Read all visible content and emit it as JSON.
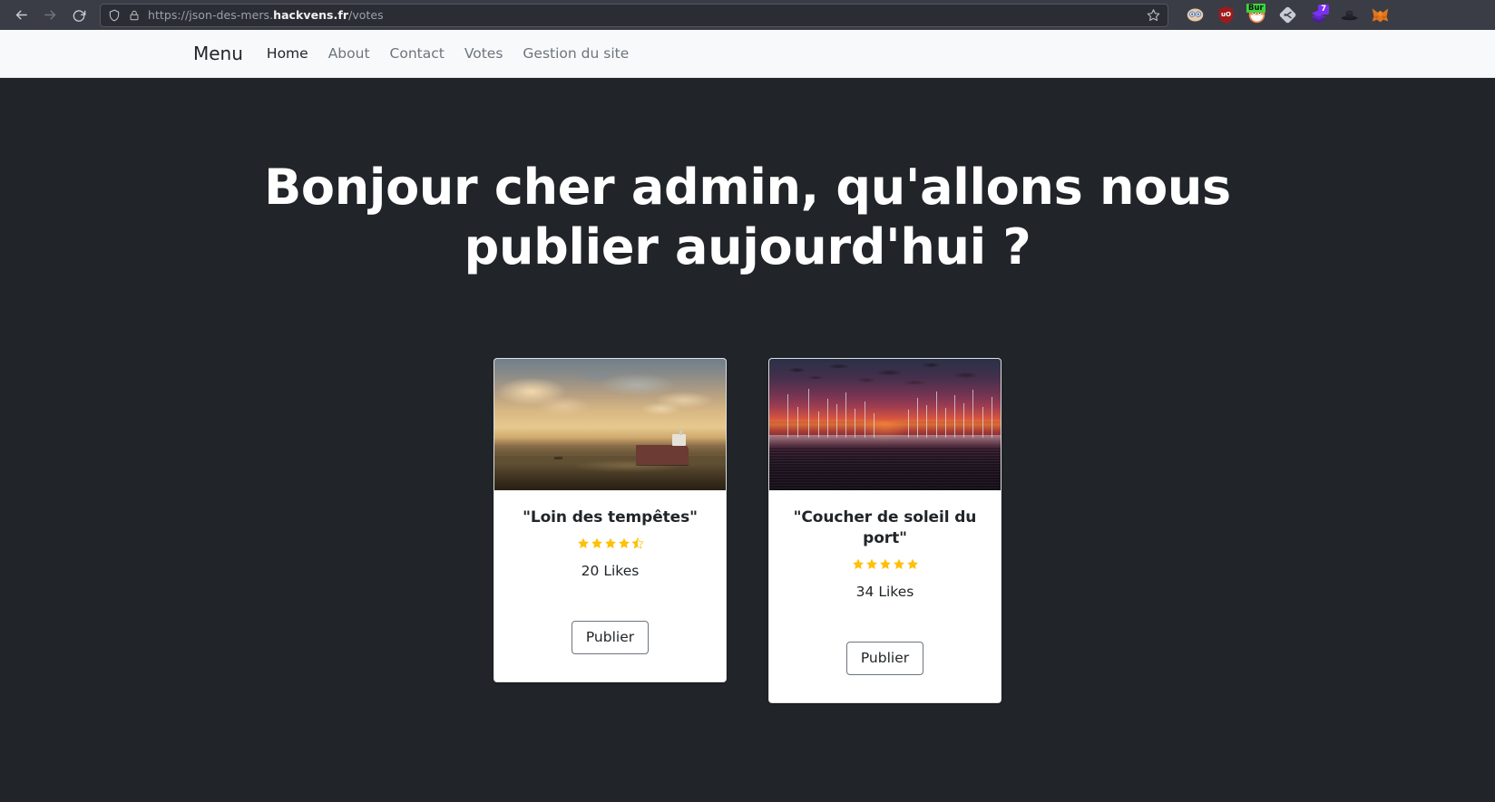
{
  "browser": {
    "back_icon": "back-arrow-icon",
    "forward_icon": "forward-arrow-icon",
    "reload_icon": "reload-icon",
    "shield_icon": "shield-icon",
    "lock_icon": "lock-icon",
    "url_prefix": "https://json-des-mers.",
    "url_domain": "hackvens.fr",
    "url_suffix": "/votes",
    "bookmark_icon": "star-bookmark-icon",
    "extensions": [
      {
        "name": "face-extension-icon",
        "label": ""
      },
      {
        "name": "ublock-origin-icon",
        "label": "uO"
      },
      {
        "name": "burp-suite-icon",
        "label": "Bur"
      },
      {
        "name": "diamond-extension-icon",
        "label": ""
      },
      {
        "name": "layers-extension-icon",
        "label": "",
        "badge": "7"
      },
      {
        "name": "hat-extension-icon",
        "label": ""
      },
      {
        "name": "metamask-fox-icon",
        "label": ""
      }
    ]
  },
  "navbar": {
    "brand": "Menu",
    "links": [
      {
        "label": "Home",
        "active": true
      },
      {
        "label": "About",
        "active": false
      },
      {
        "label": "Contact",
        "active": false
      },
      {
        "label": "Votes",
        "active": false
      },
      {
        "label": "Gestion du site",
        "active": false
      }
    ]
  },
  "page": {
    "heading": "Bonjour cher admin, qu'allons nous publier aujourd'hui ?",
    "background_color": "#212529",
    "navbar_color": "#f8f9fa",
    "star_color": "#ffc107"
  },
  "cards": [
    {
      "image_name": "cargo-ship-sunset-photo",
      "title": "\"Loin des tempêtes\"",
      "rating": 4.5,
      "likes": "20 Likes",
      "button_label": "Publier"
    },
    {
      "image_name": "harbor-sunset-photo",
      "title": "\"Coucher de soleil du port\"",
      "rating": 5,
      "likes": "34 Likes",
      "button_label": "Publier"
    }
  ]
}
